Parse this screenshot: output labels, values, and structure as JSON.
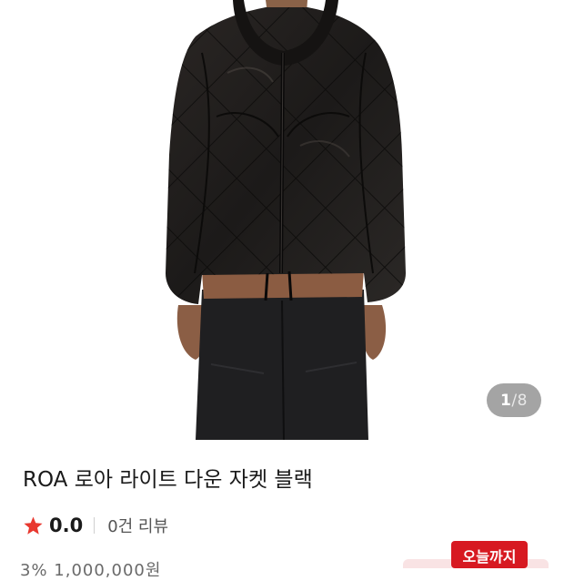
{
  "product": {
    "image_counter": {
      "current": "1",
      "separator": "/",
      "total": "8"
    },
    "title": "ROA 로아 라이트 다운 자켓 블랙",
    "rating": {
      "value": "0.0",
      "review_text": "0건 리뷰",
      "star_color": "#e8382f"
    },
    "price_partial": "3% 1,000,000원",
    "badge": {
      "label": "오늘까지",
      "color": "#d71921"
    }
  },
  "icons": {
    "rating_icon": "star-icon"
  }
}
